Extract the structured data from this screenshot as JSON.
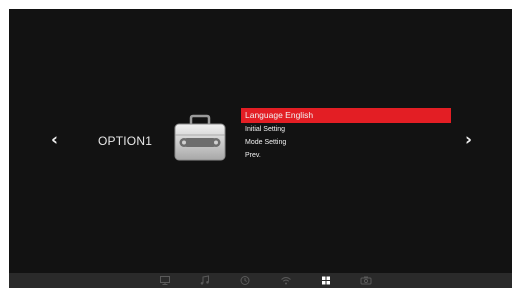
{
  "navigation": {
    "prev_arrow": "‹",
    "next_arrow": "›"
  },
  "section": {
    "title": "OPTION1",
    "icon": "toolbox-icon"
  },
  "menu": {
    "items": [
      {
        "label": "Language English",
        "selected": true
      },
      {
        "label": "Initial Setting",
        "selected": false
      },
      {
        "label": "Mode Setting",
        "selected": false
      },
      {
        "label": "Prev.",
        "selected": false
      }
    ]
  },
  "bottom_bar": {
    "icons": [
      "monitor-icon",
      "music-note-icon",
      "clock-icon",
      "wifi-icon",
      "grid-icon",
      "camera-icon"
    ],
    "active": "grid-icon"
  },
  "colors": {
    "selection": "#e31e24",
    "background": "#121212",
    "bar": "#2a2a2a",
    "active_icon": "#ffffff",
    "inactive_icon": "#5a5a5a"
  }
}
